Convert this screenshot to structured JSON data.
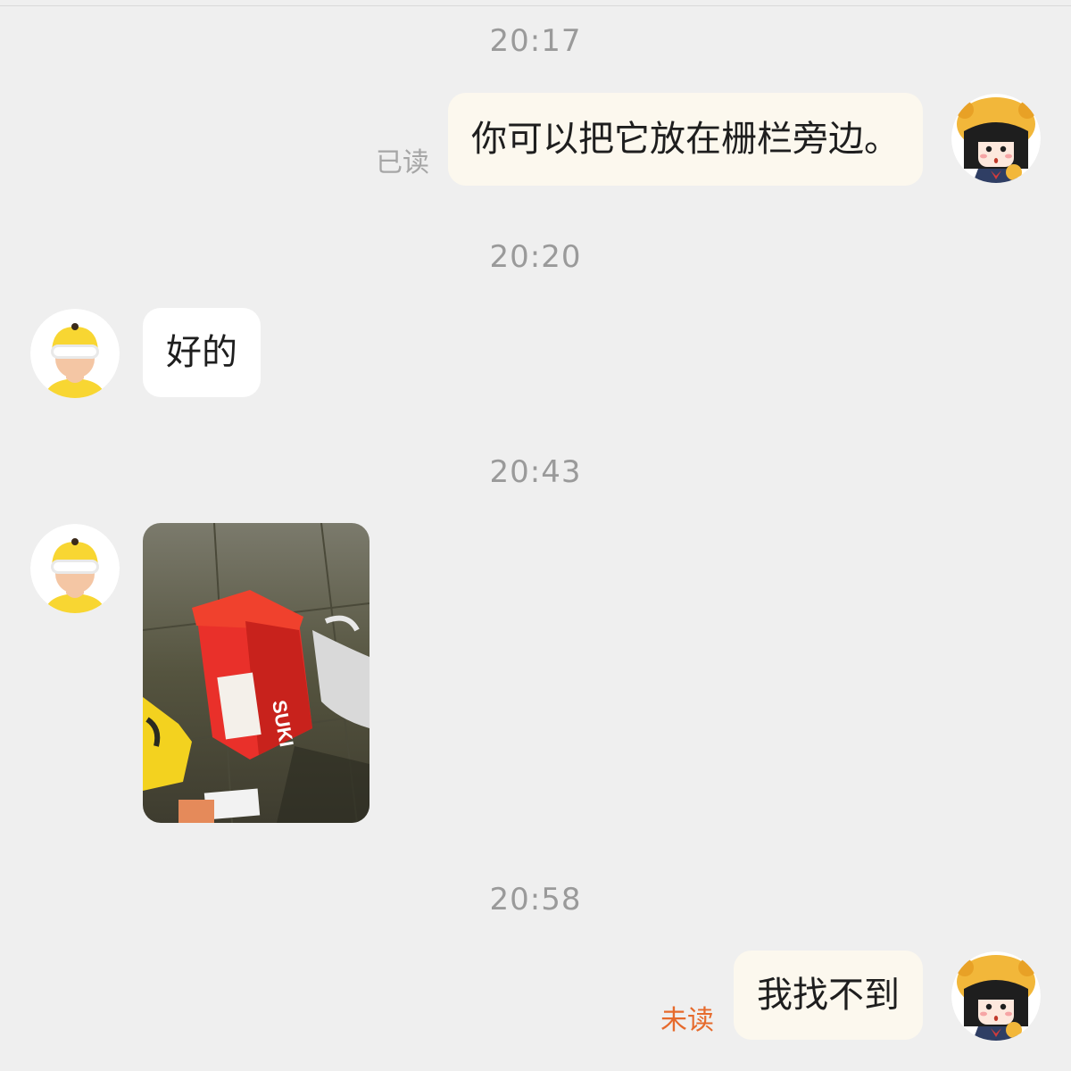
{
  "messages": [
    {
      "time": "20:17",
      "sender": "self",
      "text": "你可以把它放在栅栏旁边。",
      "status": "已读"
    },
    {
      "time": "20:20",
      "sender": "courier",
      "text": "好的"
    },
    {
      "time": "20:43",
      "sender": "courier",
      "attachment": "photo"
    },
    {
      "time": "20:58",
      "sender": "self",
      "text": "我找不到",
      "status": "未读"
    }
  ],
  "colors": {
    "background": "#efefef",
    "self_bubble": "#fcf8ee",
    "other_bubble": "#ffffff",
    "timestamp": "#9a9a9a",
    "status_read": "#a6a6a6",
    "status_unread": "#e66a2c",
    "courier_yellow": "#f8d632"
  },
  "icons": {
    "self_avatar": "cartoon-girl-bear-hat-avatar",
    "courier_avatar": "courier-helmet-avatar",
    "photo": "delivery-bag-photo"
  }
}
